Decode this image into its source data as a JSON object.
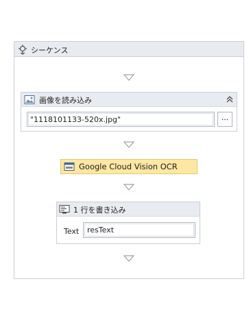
{
  "sequence": {
    "title": "シーケンス",
    "icon": "sequence-icon"
  },
  "activities": {
    "read_image": {
      "title": "画像を読み込み",
      "icon": "image-icon",
      "path_value": "\"1118101133-520x.jpg\"",
      "browse_label": "..."
    },
    "ocr": {
      "title": "Google Cloud Vision OCR",
      "icon": "ocr-icon"
    },
    "write_line": {
      "title": "1 行を書き込み",
      "icon": "write-line-icon",
      "field_label": "Text",
      "field_value": "resText"
    }
  },
  "colors": {
    "header_bg": "#e8ebf0",
    "border": "#c9ced6",
    "ocr_bg": "#fde7a3",
    "ocr_border": "#e2c86a",
    "arrow": "#9aa3ae"
  }
}
